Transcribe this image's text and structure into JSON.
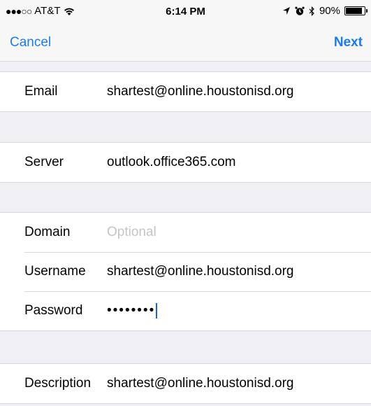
{
  "status_bar": {
    "signal_dots": "●●●○○",
    "carrier": "AT&T",
    "wifi_icon": "wifi-icon",
    "time": "6:14 PM",
    "location_icon": "location-arrow-icon",
    "alarm_icon": "alarm-clock-icon",
    "bluetooth_icon": "bluetooth-icon",
    "battery_percent": "90%",
    "battery_level": 0.9
  },
  "nav": {
    "cancel_label": "Cancel",
    "next_label": "Next"
  },
  "form": {
    "email": {
      "label": "Email",
      "value": "shartest@online.houstonisd.org"
    },
    "server": {
      "label": "Server",
      "value": "outlook.office365.com"
    },
    "domain": {
      "label": "Domain",
      "placeholder": "Optional"
    },
    "username": {
      "label": "Username",
      "value": "shartest@online.houstonisd.org"
    },
    "password": {
      "label": "Password",
      "value": "••••••••"
    },
    "description": {
      "label": "Description",
      "value": "shartest@online.houstonisd.org"
    }
  },
  "colors": {
    "accent": "#1a7cf5",
    "background": "#efeff4",
    "placeholder": "#c4c4c9"
  }
}
